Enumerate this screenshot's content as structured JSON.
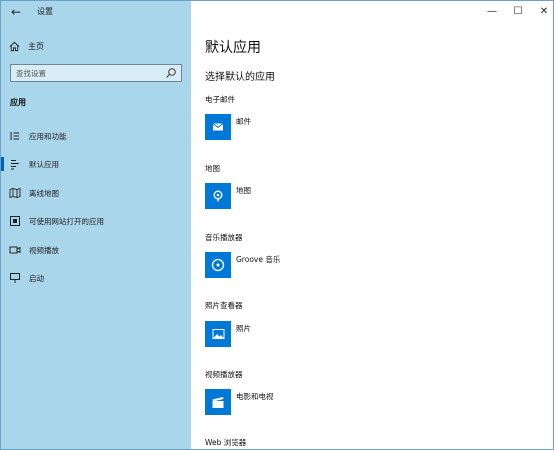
{
  "window": {
    "back_glyph": "←",
    "title": "设置",
    "controls": {
      "minimize": "—",
      "maximize": "☐",
      "close": "✕"
    }
  },
  "sidebar": {
    "home_label": "主页",
    "search_placeholder": "查找设置",
    "section_title": "应用",
    "items": [
      {
        "label": "应用和功能",
        "icon": "apps-features-icon",
        "selected": false
      },
      {
        "label": "默认应用",
        "icon": "default-apps-icon",
        "selected": true
      },
      {
        "label": "离线地图",
        "icon": "offline-maps-icon",
        "selected": false
      },
      {
        "label": "可使用网站打开的应用",
        "icon": "apps-for-websites-icon",
        "selected": false
      },
      {
        "label": "视频播放",
        "icon": "video-playback-icon",
        "selected": false
      },
      {
        "label": "启动",
        "icon": "startup-icon",
        "selected": false
      }
    ]
  },
  "main": {
    "title": "默认应用",
    "subtitle": "选择默认的应用",
    "categories": [
      {
        "label": "电子邮件",
        "app": "邮件",
        "icon": "mail-icon"
      },
      {
        "label": "地图",
        "app": "地图",
        "icon": "maps-icon"
      },
      {
        "label": "音乐播放器",
        "app": "Groove 音乐",
        "icon": "groove-music-icon"
      },
      {
        "label": "照片查看器",
        "app": "照片",
        "icon": "photos-icon"
      },
      {
        "label": "视频播放器",
        "app": "电影和电视",
        "icon": "movies-tv-icon"
      },
      {
        "label": "Web 浏览器",
        "app": "",
        "icon": ""
      }
    ]
  },
  "colors": {
    "sidebar_bg": "#a9d6ea",
    "accent": "#0078d7",
    "selection_bar": "#0063b1"
  }
}
